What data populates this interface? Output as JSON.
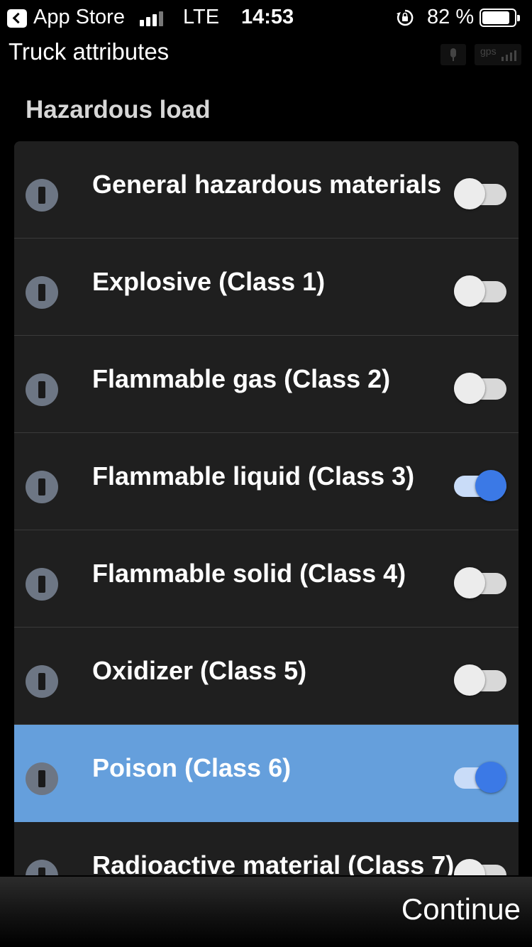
{
  "status_bar": {
    "back_app": "App Store",
    "network": "LTE",
    "time": "14:53",
    "battery": "82 %"
  },
  "header": {
    "title": "Truck attributes",
    "gps_label": "gps"
  },
  "section_title": "Hazardous load",
  "items": [
    {
      "label": "General hazardous materials",
      "enabled": false
    },
    {
      "label": "Explosive (Class 1)",
      "enabled": false
    },
    {
      "label": "Flammable gas (Class 2)",
      "enabled": false
    },
    {
      "label": "Flammable liquid (Class 3)",
      "enabled": true
    },
    {
      "label": "Flammable solid (Class 4)",
      "enabled": false
    },
    {
      "label": "Oxidizer (Class 5)",
      "enabled": false
    },
    {
      "label": "Poison (Class 6)",
      "enabled": true,
      "selected": true
    },
    {
      "label": "Radioactive material (Class 7)",
      "enabled": false
    }
  ],
  "footer": {
    "continue_label": "Continue"
  },
  "colors": {
    "selected_row": "#659fdc",
    "toggle_on": "#3b79e6"
  }
}
